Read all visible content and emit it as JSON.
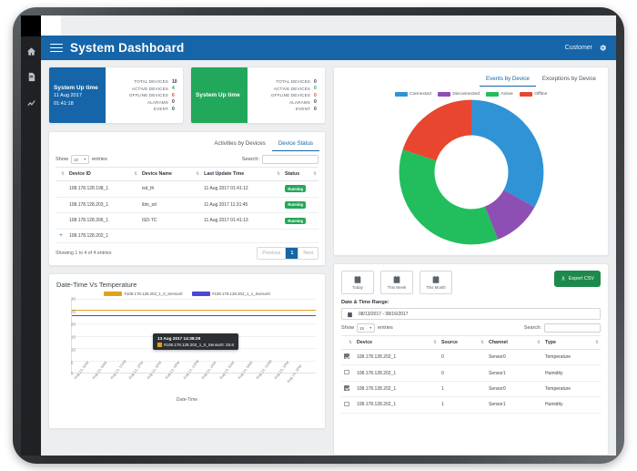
{
  "topbar": {
    "menu_icon": "hamburger-icon",
    "title": "System Dashboard",
    "customer_label": "Customer",
    "settings_icon": "gear-icon"
  },
  "rail": {
    "items": [
      {
        "icon": "home-icon",
        "name": "home"
      },
      {
        "icon": "device-icon",
        "name": "devices"
      },
      {
        "icon": "chart-icon",
        "name": "analytics"
      }
    ]
  },
  "stat_cards": [
    {
      "color": "#1565a8",
      "uptime_title": "System Up time",
      "uptime_date": "11 Aug 2017",
      "uptime_time": "01:41:18",
      "metrics": [
        {
          "label": "TOTAL DEVICES",
          "value": "10",
          "color": "#2e363d"
        },
        {
          "label": "ACTIVE DEVICES",
          "value": "4",
          "color": "#22a85a"
        },
        {
          "label": "OFFLINE DEVICES",
          "value": "6",
          "color": "#e8462f"
        },
        {
          "label": "ALARAMS",
          "value": "0",
          "color": "#2e363d"
        },
        {
          "label": "EVENT",
          "value": "0",
          "color": "#2e363d"
        }
      ]
    },
    {
      "color": "#22a85a",
      "uptime_title": "System Up time",
      "uptime_date": "",
      "uptime_time": "",
      "metrics": [
        {
          "label": "TOTAL DEVICES",
          "value": "0",
          "color": "#2e363d"
        },
        {
          "label": "ACTIVE DEVICES",
          "value": "0",
          "color": "#22a85a"
        },
        {
          "label": "OFFLINE DEVICES",
          "value": "0",
          "color": "#e8462f"
        },
        {
          "label": "ALARAMS",
          "value": "0",
          "color": "#2e363d"
        },
        {
          "label": "EVENT",
          "value": "0",
          "color": "#2e363d"
        }
      ]
    }
  ],
  "device_panel": {
    "tabs": [
      {
        "label": "Activities by Devices",
        "active": false
      },
      {
        "label": "Device Status",
        "active": true
      }
    ],
    "show_label": "Show",
    "entries_label": "entries",
    "page_size": "10",
    "search_label": "Search:",
    "search_value": "",
    "columns": [
      "",
      "Device ID",
      "Device Name",
      "Last Update Time",
      "Status"
    ],
    "rows": [
      {
        "expand": "",
        "device_id": "108.178.128.198_1",
        "device_name": "isd_th",
        "last_update": "11 Aug 2017 01:41:12",
        "status": "Running"
      },
      {
        "expand": "",
        "device_id": "108.178.128.203_1",
        "device_name": "ibtx_sd",
        "last_update": "11 Aug 2017 11:31:45",
        "status": "Running"
      },
      {
        "expand": "",
        "device_id": "108.178.128.206_1",
        "device_name": "iSD-TC",
        "last_update": "11 Aug 2017 01:41:13",
        "status": "Running"
      },
      {
        "expand": "+",
        "device_id": "108.178.128.202_1",
        "device_name": "",
        "last_update": "",
        "status": ""
      }
    ],
    "showing_text": "Showing 1 to 4 of 4 entries",
    "pager": {
      "previous": "Previous",
      "current": "1",
      "next": "Next"
    }
  },
  "events_panel": {
    "tabs": [
      {
        "label": "Events by Device",
        "active": true
      },
      {
        "label": "Exceptions by Device",
        "active": false
      }
    ],
    "chart_data": {
      "type": "pie",
      "title": "Events by Device",
      "categories": [
        "Connected",
        "Disconnected",
        "Active",
        "Offline"
      ],
      "values": [
        33,
        11,
        36,
        20
      ],
      "colors": [
        "#2f93d6",
        "#8e4fb5",
        "#22bd5c",
        "#e8462f"
      ],
      "legend_position": "top",
      "donut": true
    }
  },
  "temperature_panel": {
    "chart_data": {
      "type": "line",
      "title": "Date-Time Vs Temperature",
      "xlabel": "Date-Time",
      "ylabel": "",
      "ylim": [
        0,
        30
      ],
      "yticks": [
        "30",
        "25",
        "20",
        "15",
        "10",
        "5",
        "0"
      ],
      "xticks": [
        "Aug 13, 5AM",
        "Aug 13, 8AM",
        "Aug 13, 11AM",
        "Aug 13, 2PM",
        "Aug 13, 5PM",
        "Aug 13, 8PM",
        "Aug 13, 11PM",
        "Aug 14, 2AM",
        "Aug 14, 5AM",
        "Aug 14, 8AM",
        "Aug 14, 11AM",
        "Aug 14, 2PM",
        "Aug 14, 3PM"
      ],
      "series": [
        {
          "name": "#108.178.128.202_1_0_Sensor0",
          "color": "#e0a11c",
          "value": 25.8
        },
        {
          "name": "#108.178.128.202_1_1_Sensor0",
          "color": "#4c48cf",
          "value": 23.6
        }
      ],
      "tooltip": {
        "title": "13 Aug 2017 14:38:29",
        "entry": "#108.178.128.202_1_0_Sensor0: 25.8",
        "swatch_color": "#e0a11c"
      }
    }
  },
  "data_panel": {
    "range_buttons": [
      {
        "label": "Today",
        "icon": "calendar-icon"
      },
      {
        "label": "This Week",
        "icon": "calendar-icon"
      },
      {
        "label": "This Month",
        "icon": "calendar-icon"
      }
    ],
    "export_button": {
      "label": "Export CSV",
      "icon": "download-icon",
      "color": "#1d8a4b"
    },
    "range_title": "Date & Time Range:",
    "range_value": "08/13/2017 - 08/16/2017",
    "range_icon": "calendar-icon",
    "show_label": "Show",
    "entries_label": "entries",
    "page_size": "15",
    "search_label": "Search:",
    "search_value": "",
    "columns": [
      "",
      "Device",
      "Source",
      "Channel",
      "Type"
    ],
    "rows": [
      {
        "checked": true,
        "device": "108.178.128.202_1",
        "source": "0",
        "channel": "Sensor0",
        "type": "Temperature"
      },
      {
        "checked": false,
        "device": "108.178.128.202_1",
        "source": "0",
        "channel": "Sensor1",
        "type": "Humidity"
      },
      {
        "checked": true,
        "device": "108.178.128.202_1",
        "source": "1",
        "channel": "Sensor0",
        "type": "Temperature"
      },
      {
        "checked": false,
        "device": "108.178.128.202_1",
        "source": "1",
        "channel": "Sensor1",
        "type": "Humidity"
      }
    ]
  }
}
